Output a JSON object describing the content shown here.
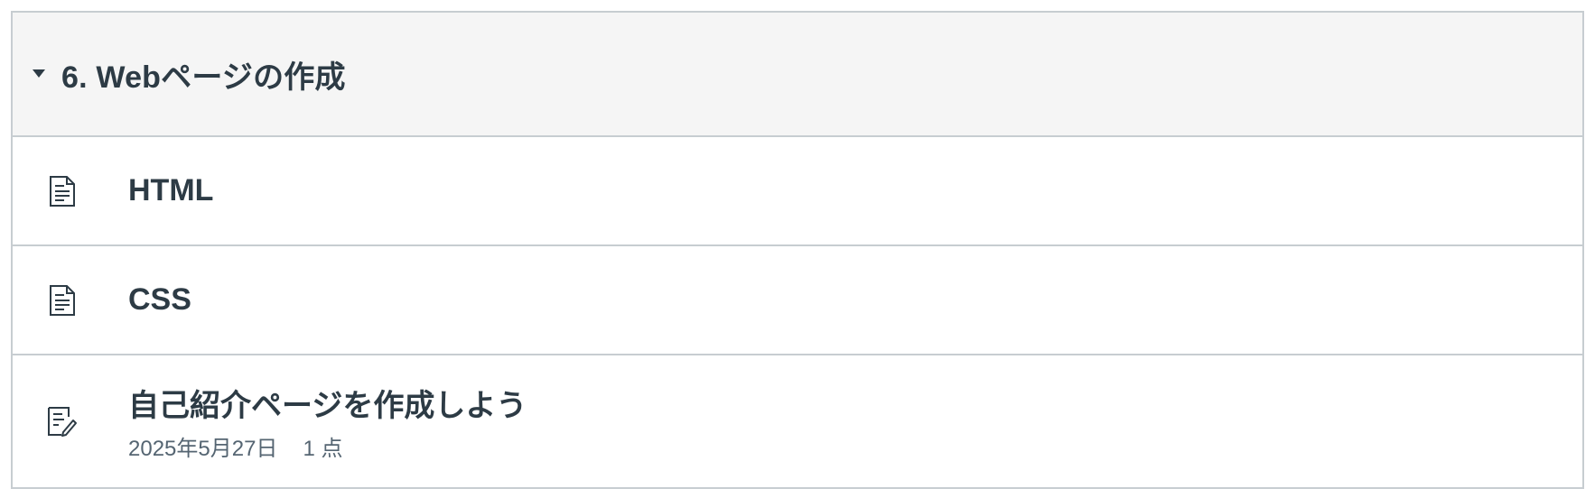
{
  "module": {
    "title": "6. Webページの作成",
    "items": [
      {
        "type": "page",
        "icon": "document-icon",
        "title": "HTML"
      },
      {
        "type": "page",
        "icon": "document-icon",
        "title": "CSS"
      },
      {
        "type": "assignment",
        "icon": "assignment-edit-icon",
        "title": "自己紹介ページを作成しよう",
        "due_date": "2025年5月27日",
        "points": "1 点"
      }
    ]
  },
  "colors": {
    "border": "#c7cdd1",
    "header_bg": "#f5f5f5",
    "text": "#2d3b45",
    "meta_text": "#556572"
  }
}
